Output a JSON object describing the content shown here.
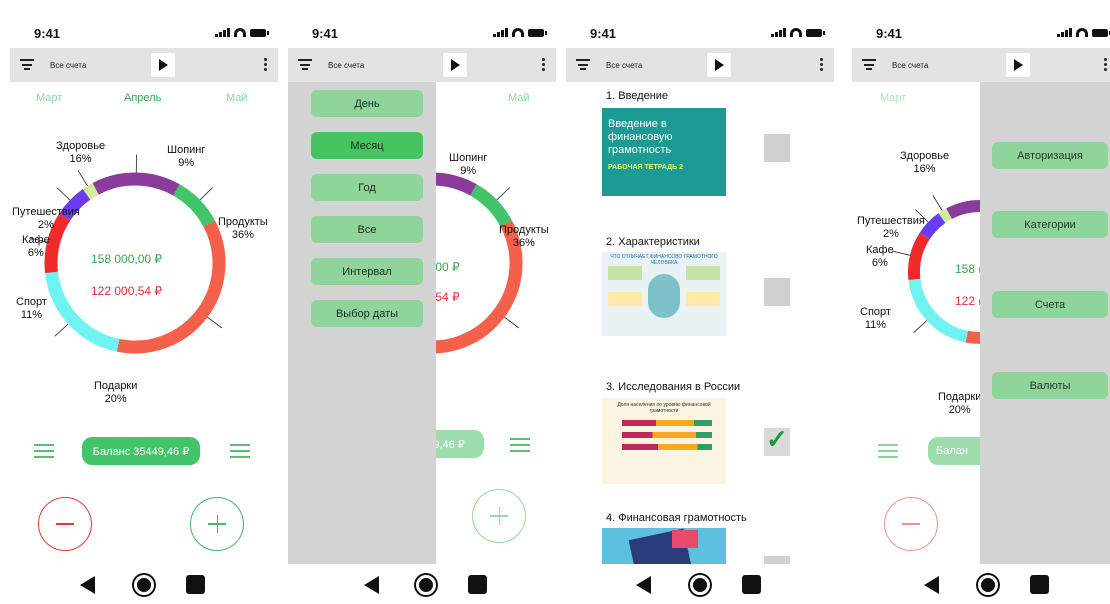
{
  "status_time": "9:41",
  "toolbar": {
    "accounts_label": "Все счета"
  },
  "months": {
    "prev": "Март",
    "current": "Апрель",
    "next": "Май"
  },
  "chart_data": {
    "type": "pie",
    "title": "",
    "categories": [
      "Здоровье",
      "Шопинг",
      "Продукты",
      "Подарки",
      "Спорт",
      "Кафе",
      "Путешествия"
    ],
    "values": [
      16,
      9,
      36,
      20,
      11,
      6,
      2
    ],
    "labels": [
      "16%",
      "9%",
      "36%",
      "20%",
      "11%",
      "6%",
      "2%"
    ],
    "colors": [
      "#8a3b9b",
      "#43c46a",
      "#f5604a",
      "#6ef3f0",
      "#f02a2a",
      "#6a3df0",
      "#d2eb9c"
    ],
    "hole": "donut"
  },
  "totals": {
    "income": "158 000,00 ₽",
    "expense": "122 000,54 ₽",
    "income_partial": ",00 ₽",
    "expense_partial": ",54 ₽",
    "income_short": "158 (",
    "expense_short": "122 ("
  },
  "balance": {
    "label": "Баланс  35449,46 ₽",
    "partial": "49,46 ₽",
    "short": "Балан"
  },
  "period_menu": [
    "День",
    "Месяц",
    "Год",
    "Все",
    "Интервал",
    "Выбор даты"
  ],
  "lessons": [
    {
      "title": "1. Введение",
      "done": false,
      "thumb_text": "Введение в финансовую грамотность",
      "thumb_sub": "РАБОЧАЯ ТЕТРАДЬ 2"
    },
    {
      "title": "2. Характеристики",
      "done": false,
      "thumb_text": "ЧТО ОТЛИЧАЕТ ФИНАНСОВО ГРАМОТНОГО ЧЕЛОВЕКА"
    },
    {
      "title": "3. Исследования в России",
      "done": true,
      "thumb_text": "Доля населения по уровню финансовой грамотности"
    },
    {
      "title": "4. Финансовая грамотность",
      "done": false
    }
  ],
  "side_menu": [
    "Авторизация",
    "Категории",
    "Счета",
    "Валюты"
  ],
  "check_mark": "✓"
}
